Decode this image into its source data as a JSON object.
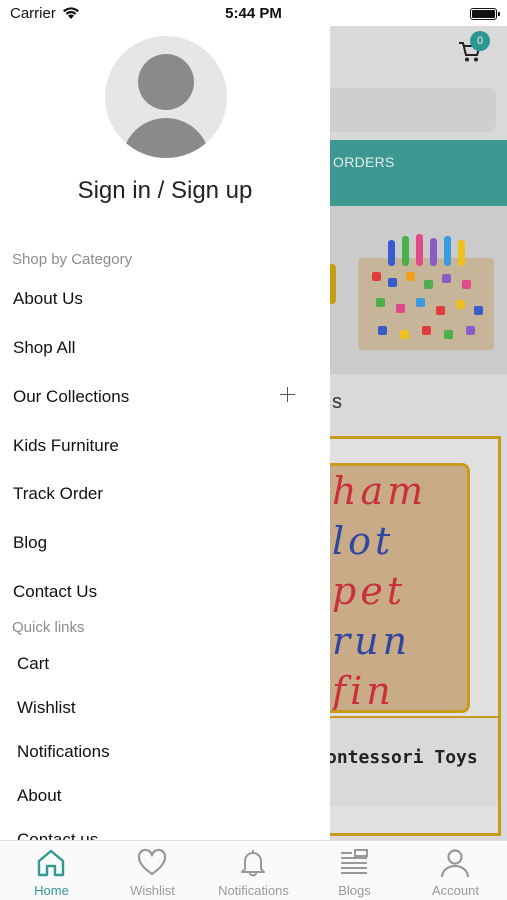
{
  "status_bar": {
    "carrier": "Carrier",
    "time": "5:44 PM"
  },
  "drawer": {
    "auth_label": "Sign in / Sign up",
    "shop_section_title": "Shop by Category",
    "categories": [
      {
        "label": "About Us"
      },
      {
        "label": "Shop All"
      },
      {
        "label": "Our Collections",
        "expandable": true
      },
      {
        "label": "Kids Furniture"
      },
      {
        "label": "Track Order"
      },
      {
        "label": "Blog"
      },
      {
        "label": "Contact Us"
      }
    ],
    "quick_links_title": "Quick links",
    "quick_links": [
      {
        "label": "Cart"
      },
      {
        "label": "Wishlist"
      },
      {
        "label": "Notifications"
      },
      {
        "label": "About"
      },
      {
        "label": "Contact us"
      }
    ]
  },
  "background_screen": {
    "cart_count": "0",
    "promo_text": "ORDERS",
    "section_heading_fragment": "s",
    "block_letters": [
      "ham",
      "lot",
      "pet",
      "run",
      "fin"
    ],
    "product_caption": "ontessori Toys"
  },
  "tab_bar": {
    "tabs": [
      {
        "label": "Home",
        "icon": "home-icon",
        "active": true
      },
      {
        "label": "Wishlist",
        "icon": "heart-icon",
        "active": false
      },
      {
        "label": "Notifications",
        "icon": "bell-icon",
        "active": false
      },
      {
        "label": "Blogs",
        "icon": "blogs-icon",
        "active": false
      },
      {
        "label": "Account",
        "icon": "person-icon",
        "active": false
      }
    ]
  },
  "colors": {
    "accent": "#2e9a94",
    "teal_banner": "#3c9891",
    "muted_text": "#8c8c8c"
  }
}
